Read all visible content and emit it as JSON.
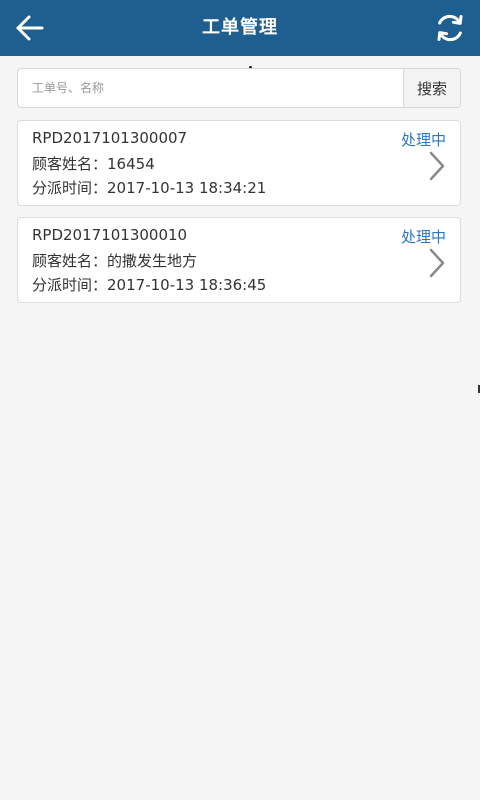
{
  "header": {
    "title": "工单管理",
    "back_icon": "arrow-left-icon",
    "refresh_icon": "refresh-icon",
    "background_color": "#1f5f8f"
  },
  "search": {
    "placeholder": "工单号、名称",
    "value": "",
    "button_label": "搜索"
  },
  "orders": [
    {
      "order_no": "RPD2017101300007",
      "status": "处理中",
      "customer_label": "顾客姓名：",
      "customer_name": "16454",
      "time_label": "分派时间：",
      "assign_time": "2017-10-13 18:34:21"
    },
    {
      "order_no": "RPD2017101300010",
      "status": "处理中",
      "customer_label": "顾客姓名：",
      "customer_name": "的撒发生地方",
      "time_label": "分派时间：",
      "assign_time": "2017-10-13 18:36:45"
    }
  ],
  "colors": {
    "status": "#2a76c6",
    "page_background": "#f5f5f5"
  }
}
